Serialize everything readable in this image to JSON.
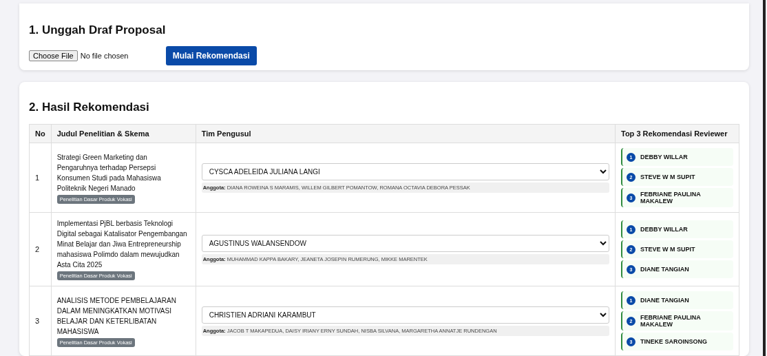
{
  "upload": {
    "title": "1. Unggah Draf Proposal",
    "file_button": "Choose File",
    "file_status": "No file chosen",
    "start_button": "Mulai Rekomendasi"
  },
  "results": {
    "title": "2. Hasil Rekomendasi",
    "columns": [
      "No",
      "Judul Penelitian & Skema",
      "Tim Pengusul",
      "Top 3 Rekomendasi Reviewer"
    ],
    "rows": [
      {
        "no": "1",
        "title": "Strategi Green Marketing dan Pengaruhnya terhadap Persepsi Konsumen Studi pada Mahasiswa Politeknik Negeri Manado",
        "scheme": "Penelitian Dasar Produk Vokasi",
        "leader": "CYSCA ADELEIDA JULIANA LANGI",
        "members": "**Anggota:** DIANA ROWEINA S MARAMIS, WILLEM GILBERT POMANTOW, ROMANA OCTAVIA DEBORA PESSAK",
        "reviewers": [
          {
            "rank": "1",
            "name": "DEBBY WILLAR"
          },
          {
            "rank": "2",
            "name": "STEVE W M SUPIT"
          },
          {
            "rank": "3",
            "name": "FEBRIANE PAULINA MAKALEW"
          }
        ]
      },
      {
        "no": "2",
        "title": "Implementasi PjBL berbasis Teknologi Digital sebagai Katalisator Pengembangan Minat Belajar dan Jiwa Entrepreneurship mahasiswa Polimdo dalam mewujudkan Asta Cita 2025",
        "scheme": "Penelitian Dasar Produk Vokasi",
        "leader": "AGUSTINUS WALANSENDOW",
        "members": "**Anggota:** MUHAMMAD KAPPA BAKARY, JEANETA JOSEPIN RUMERUNG, MIKKE MARENTEK",
        "reviewers": [
          {
            "rank": "1",
            "name": "DEBBY WILLAR"
          },
          {
            "rank": "2",
            "name": "STEVE W M SUPIT"
          },
          {
            "rank": "3",
            "name": "DIANE TANGIAN"
          }
        ]
      },
      {
        "no": "3",
        "title": "ANALISIS METODE PEMBELAJARAN DALAM MENINGKATKAN MOTIVASI BELAJAR DAN KETERLIBATAN MAHASISWA",
        "scheme": "Penelitian Dasar Produk Vokasi",
        "leader": "CHRISTIEN ADRIANI KARAMBUT",
        "members": "**Anggota:** JACOB T MAKAPEDUA, DAISY IRIANY ERNY SUNDAH, NISBA SILVANA, MARGARETHA ANNATJE RUNDENGAN",
        "reviewers": [
          {
            "rank": "1",
            "name": "DIANE TANGIAN"
          },
          {
            "rank": "2",
            "name": "FEBRIANE PAULINA MAKALEW"
          },
          {
            "rank": "3",
            "name": "TINEKE SAROINSONG"
          }
        ]
      }
    ]
  }
}
